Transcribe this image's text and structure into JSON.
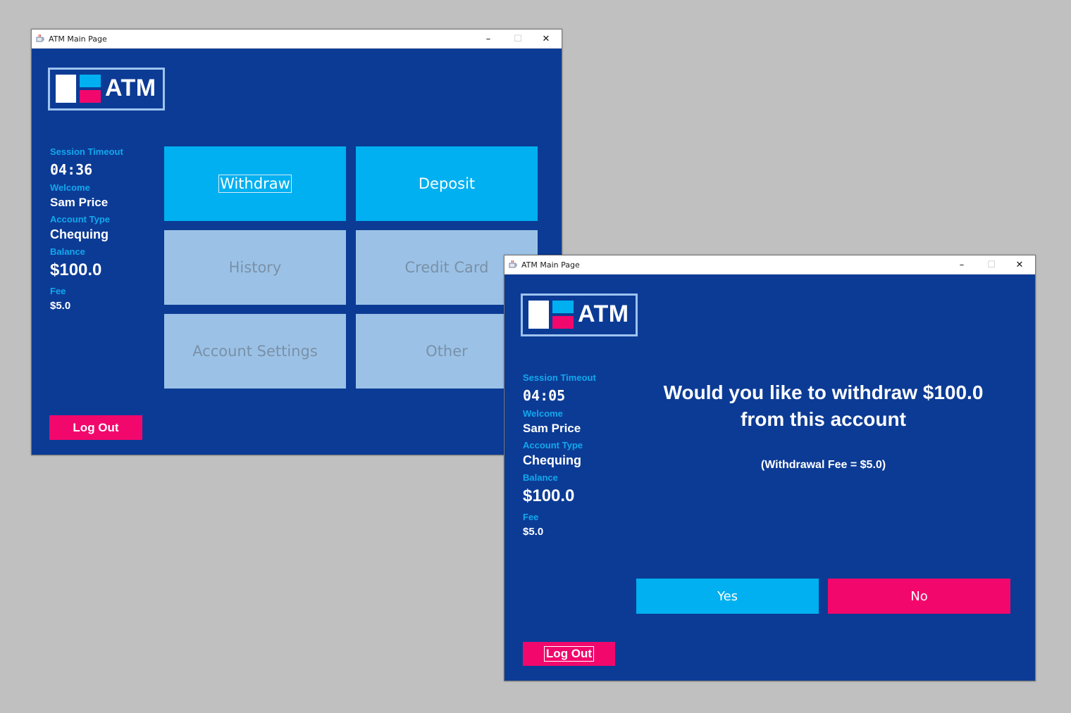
{
  "colors": {
    "desktop": "#c0c0c0",
    "window_bg": "#0c3b95",
    "accent_blue": "#00b0f0",
    "accent_pink": "#f2086c",
    "label_blue": "#12a8ee",
    "disabled_tile": "#9bc2e6",
    "logo_border": "#9ec3f0"
  },
  "icons": [
    "java-cup-icon",
    "minimize-icon",
    "maximize-icon",
    "close-icon",
    "atm-logo"
  ],
  "windows": {
    "main": {
      "title": "ATM Main Page",
      "logo_text": "ATM",
      "session": {
        "timeout_label": "Session Timeout",
        "timeout_value": "04:36",
        "welcome_label": "Welcome",
        "welcome_value": "Sam Price",
        "account_type_label": "Account Type",
        "account_type_value": "Chequing",
        "balance_label": "Balance",
        "balance_value": "$100.0",
        "fee_label": "Fee",
        "fee_value": "$5.0"
      },
      "menu": {
        "withdraw": "Withdraw",
        "deposit": "Deposit",
        "history": "History",
        "credit_card": "Credit Card",
        "account_settings": "Account Settings",
        "other": "Other"
      },
      "logout_label": "Log Out"
    },
    "confirm": {
      "title": "ATM Main Page",
      "logo_text": "ATM",
      "session": {
        "timeout_label": "Session Timeout",
        "timeout_value": "04:05",
        "welcome_label": "Welcome",
        "welcome_value": "Sam Price",
        "account_type_label": "Account Type",
        "account_type_value": "Chequing",
        "balance_label": "Balance",
        "balance_value": "$100.0",
        "fee_label": "Fee",
        "fee_value": "$5.0"
      },
      "question_line1": "Would you like to withdraw $100.0",
      "question_line2": "from this account",
      "fee_note": "(Withdrawal Fee = $5.0)",
      "yes_label": "Yes",
      "no_label": "No",
      "logout_label": "Log Out"
    }
  }
}
